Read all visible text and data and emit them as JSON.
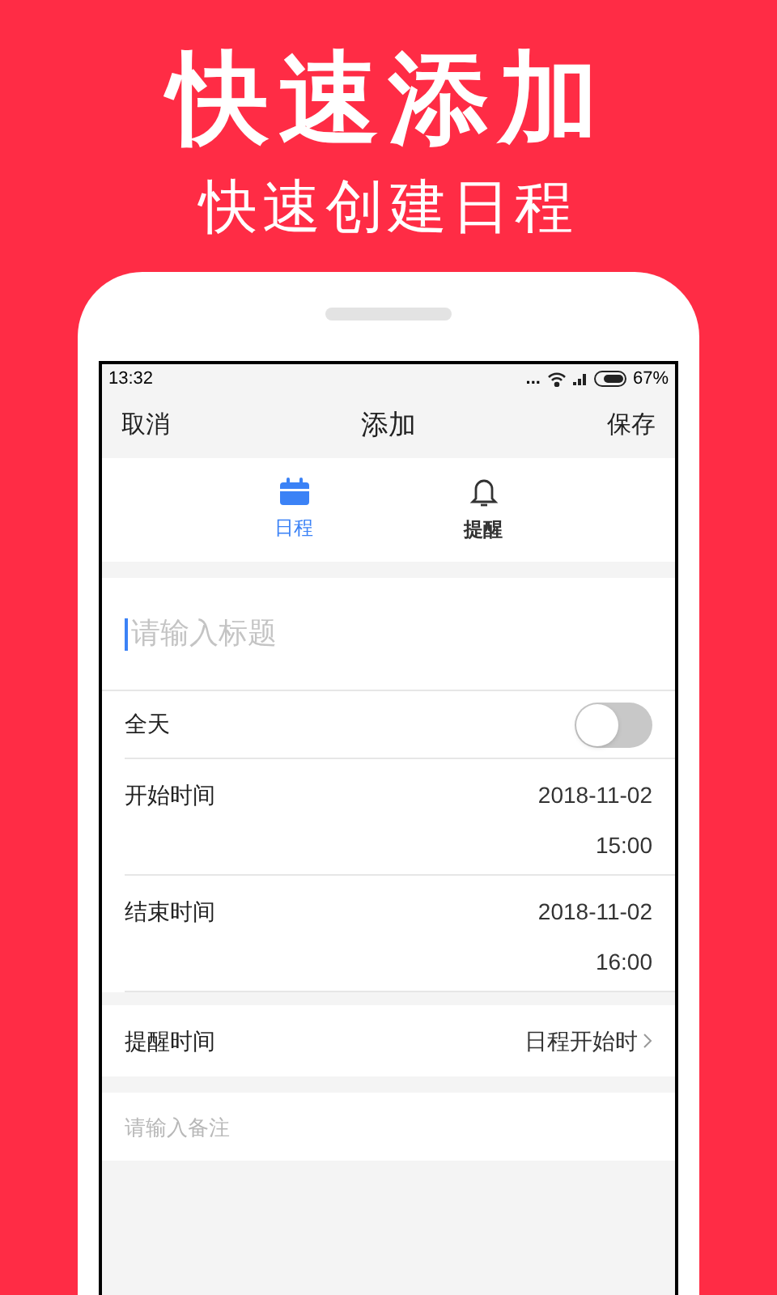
{
  "headline": "快速添加",
  "subheadline": "快速创建日程",
  "status_bar": {
    "time": "13:32",
    "dots": "...",
    "battery": "67%"
  },
  "nav": {
    "cancel": "取消",
    "title": "添加",
    "save": "保存"
  },
  "tabs": [
    {
      "label": "日程",
      "kind": "calendar",
      "selected": true
    },
    {
      "label": "提醒",
      "kind": "bell",
      "selected": false
    }
  ],
  "title_field": {
    "placeholder": "请输入标题"
  },
  "all_day": {
    "label": "全天",
    "on": false
  },
  "times": [
    {
      "label": "开始时间",
      "date": "2018-11-02",
      "time": "15:00"
    },
    {
      "label": "结束时间",
      "date": "2018-11-02",
      "time": "16:00"
    }
  ],
  "reminder": {
    "label": "提醒时间",
    "value": "日程开始时"
  },
  "notes_field": {
    "placeholder": "请输入备注"
  }
}
